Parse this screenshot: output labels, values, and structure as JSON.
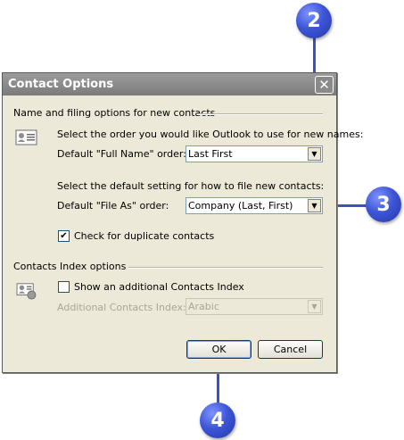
{
  "dialog": {
    "title": "Contact Options",
    "close_label": "✕"
  },
  "name_section": {
    "heading": "Name and filing options for new contacts",
    "full_name_prompt": "Select the order you would like Outlook to use for new names:",
    "full_name_label": "Default \"Full Name\" order:",
    "full_name_value": "Last First",
    "file_as_prompt": "Select the default setting for how to file new contacts:",
    "file_as_label": "Default \"File As\" order:",
    "file_as_value": "Company (Last, First)",
    "duplicate_label": "Check for duplicate contacts",
    "duplicate_checked": true
  },
  "index_section": {
    "heading": "Contacts Index options",
    "show_index_label": "Show an additional Contacts Index",
    "show_index_checked": false,
    "additional_index_label": "Additional Contacts Index:",
    "additional_index_value": "Arabic"
  },
  "buttons": {
    "ok": "OK",
    "cancel": "Cancel"
  },
  "callouts": {
    "c2": "2",
    "c3": "3",
    "c4": "4"
  },
  "icons": {
    "contact_card": "contact-card-icon",
    "contact_index": "contact-index-icon",
    "dropdown": "chevron-down-icon"
  },
  "colors": {
    "callout": "#3d56d6",
    "title_bar": "#8a8a8a",
    "dialog_bg": "#ece9d8"
  }
}
